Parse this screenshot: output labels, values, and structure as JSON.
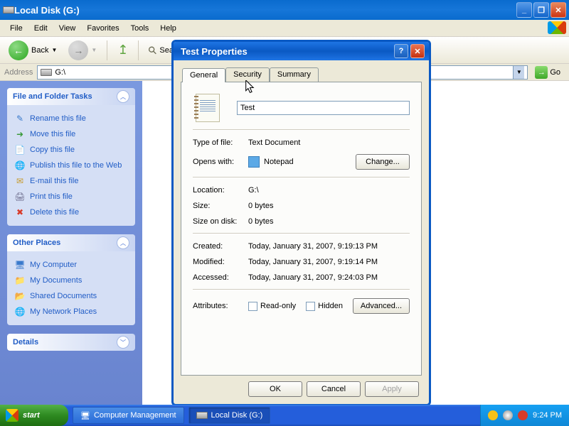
{
  "explorer": {
    "title": "Local Disk (G:)",
    "menu": [
      "File",
      "Edit",
      "View",
      "Favorites",
      "Tools",
      "Help"
    ],
    "toolbar": {
      "back": "Back",
      "search": "Search"
    },
    "address": {
      "label": "Address",
      "value": "G:\\",
      "go": "Go"
    }
  },
  "sidebar": {
    "file_tasks": {
      "title": "File and Folder Tasks",
      "items": [
        {
          "icon": "rename",
          "label": "Rename this file"
        },
        {
          "icon": "move",
          "label": "Move this file"
        },
        {
          "icon": "copy",
          "label": "Copy this file"
        },
        {
          "icon": "publish",
          "label": "Publish this file to the Web"
        },
        {
          "icon": "email",
          "label": "E-mail this file"
        },
        {
          "icon": "print",
          "label": "Print this file"
        },
        {
          "icon": "delete",
          "label": "Delete this file"
        }
      ]
    },
    "other_places": {
      "title": "Other Places",
      "items": [
        {
          "icon": "computer",
          "label": "My Computer"
        },
        {
          "icon": "documents",
          "label": "My Documents"
        },
        {
          "icon": "shared",
          "label": "Shared Documents"
        },
        {
          "icon": "network",
          "label": "My Network Places"
        }
      ]
    },
    "details": {
      "title": "Details"
    }
  },
  "dialog": {
    "title": "Test Properties",
    "tabs": [
      "General",
      "Security",
      "Summary"
    ],
    "filename": "Test",
    "fields": {
      "type_label": "Type of file:",
      "type_value": "Text Document",
      "opens_label": "Opens with:",
      "opens_value": "Notepad",
      "change_btn": "Change...",
      "location_label": "Location:",
      "location_value": "G:\\",
      "size_label": "Size:",
      "size_value": "0 bytes",
      "sizeondisk_label": "Size on disk:",
      "sizeondisk_value": "0 bytes",
      "created_label": "Created:",
      "created_value": "Today, January 31, 2007, 9:19:13 PM",
      "modified_label": "Modified:",
      "modified_value": "Today, January 31, 2007, 9:19:14 PM",
      "accessed_label": "Accessed:",
      "accessed_value": "Today, January 31, 2007, 9:24:03 PM",
      "attributes_label": "Attributes:",
      "readonly": "Read-only",
      "hidden": "Hidden",
      "advanced_btn": "Advanced..."
    },
    "buttons": {
      "ok": "OK",
      "cancel": "Cancel",
      "apply": "Apply"
    }
  },
  "taskbar": {
    "start": "start",
    "items": [
      "Computer Management",
      "Local Disk (G:)"
    ],
    "clock": "9:24 PM"
  }
}
